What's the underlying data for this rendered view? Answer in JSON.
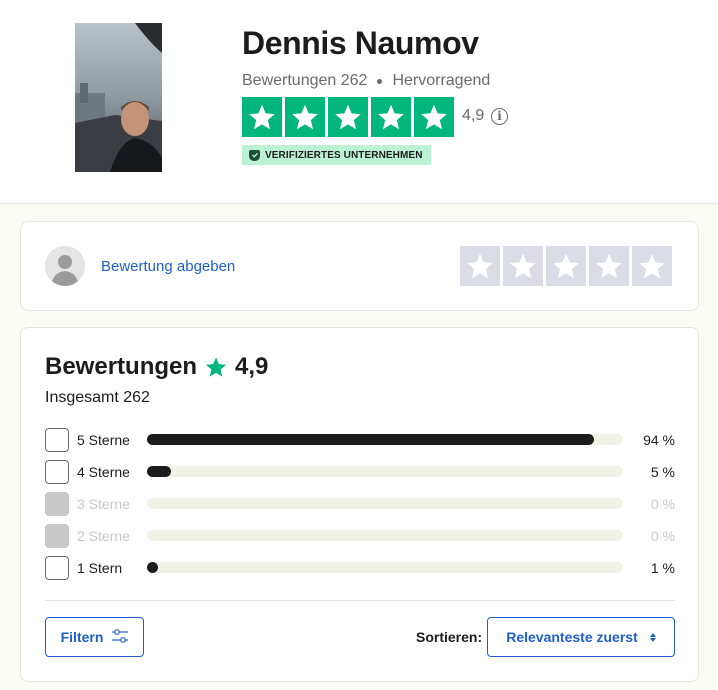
{
  "business": {
    "name": "Dennis Naumov",
    "reviews_meta": "Bewertungen 262",
    "rating_label": "Hervorragend",
    "rating_score": "4,9",
    "stars": 5,
    "verified_label": "VERIFIZIERTES UNTERNEHMEN"
  },
  "write_review": {
    "link_label": "Bewertung abgeben"
  },
  "reviews": {
    "title": "Bewertungen",
    "score": "4,9",
    "total": "Insgesamt 262",
    "distribution": [
      {
        "label": "5 Sterne",
        "percent_text": "94 %",
        "fraction": 0.94,
        "enabled": true
      },
      {
        "label": "4 Sterne",
        "percent_text": "5 %",
        "fraction": 0.05,
        "enabled": true
      },
      {
        "label": "3 Sterne",
        "percent_text": "0 %",
        "fraction": 0,
        "enabled": false
      },
      {
        "label": "2 Sterne",
        "percent_text": "0 %",
        "fraction": 0,
        "enabled": false
      },
      {
        "label": "1 Stern",
        "percent_text": "1 %",
        "fraction": 0.01,
        "enabled": true
      }
    ],
    "filter_label": "Filtern",
    "sort_label": "Sortieren:",
    "sort_value": "Relevanteste zuerst"
  },
  "colors": {
    "trustpilot_green": "#00b67a",
    "link_blue": "#1f5fcc",
    "verified_bg": "#bcf1d4"
  }
}
